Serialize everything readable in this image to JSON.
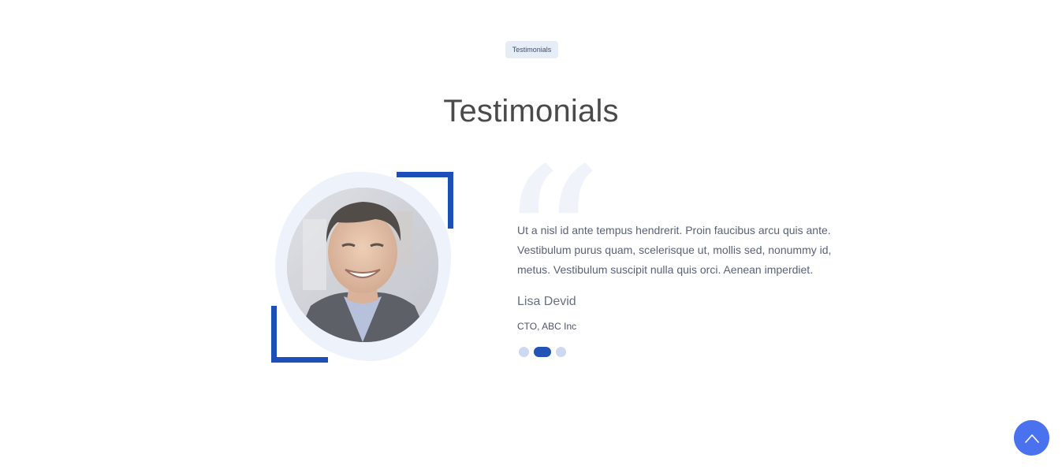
{
  "section": {
    "badge": "Testimonials",
    "title": "Testimonials"
  },
  "testimonial": {
    "quote": "Ut a nisl id ante tempus hendrerit. Proin faucibus arcu quis ante. Vestibulum purus quam, scelerisque ut, mollis sed, nonummy id, metus. Vestibulum suscipit nulla quis orci. Aenean imperdiet.",
    "author_name": "Lisa Devid",
    "author_role": "CTO, ABC Inc",
    "quote_mark": "“"
  },
  "carousel": {
    "total_slides": 3,
    "active_index": 1
  },
  "icons": {
    "scroll_top": "chevron-up-icon",
    "quote": "quote-icon"
  },
  "colors": {
    "accent": "#1d4fb8",
    "dot_active": "#2453b6",
    "dot_inactive": "#cdd9f1",
    "scroll_button": "#4a72ee",
    "badge_bg": "#e7edf7"
  }
}
